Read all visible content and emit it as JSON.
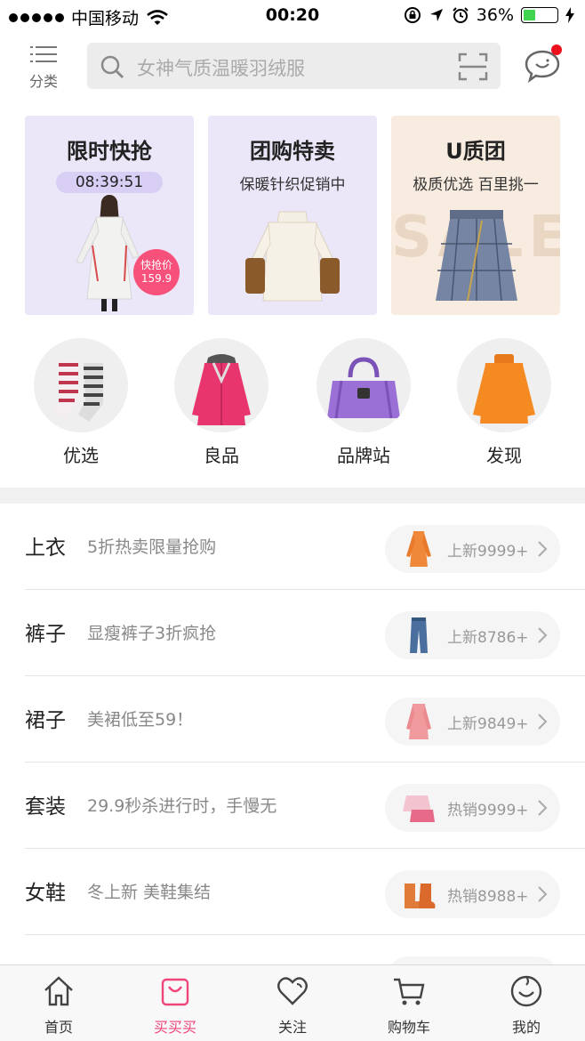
{
  "status_bar": {
    "carrier": "中国移动",
    "time": "00:20",
    "battery_percent": "36%",
    "battery_level": 0.36,
    "battery_color": "#3fd34f"
  },
  "header": {
    "category_label": "分类",
    "search_placeholder": "女神气质温暖羽绒服",
    "icons": [
      "list-icon",
      "search-icon",
      "scan-icon",
      "message-icon"
    ],
    "notification_dot_color": "#f0101d"
  },
  "promos": [
    {
      "title": "限时快抢",
      "timer": "08:39:51",
      "badge_label": "快抢价",
      "badge_price": "159.9",
      "bg": "#ebe6f8"
    },
    {
      "title": "团购特卖",
      "subtitle": "保暖针织促销中",
      "bg": "#ebe6f8"
    },
    {
      "title": "U质团",
      "subtitle": "极质优选 百里挑一",
      "watermark": "SALE",
      "bg": "#f8ece0"
    }
  ],
  "circles": [
    {
      "label": "优选",
      "icon": "socks-icon"
    },
    {
      "label": "良品",
      "icon": "coat-icon"
    },
    {
      "label": "品牌站",
      "icon": "handbag-icon"
    },
    {
      "label": "发现",
      "icon": "sweater-icon"
    }
  ],
  "list": [
    {
      "title": "上衣",
      "subtitle": "5折热卖限量抢购",
      "pill": "上新9999+",
      "icon": "trench-coat-icon"
    },
    {
      "title": "裤子",
      "subtitle": "显瘦裤子3折疯抢",
      "pill": "上新8786+",
      "icon": "jeans-icon"
    },
    {
      "title": "裙子",
      "subtitle": "美裙低至59！",
      "pill": "上新9849+",
      "icon": "pink-coat-icon"
    },
    {
      "title": "套装",
      "subtitle": "29.9秒杀进行时，手慢无",
      "pill": "热销9999+",
      "icon": "outfit-icon"
    },
    {
      "title": "女鞋",
      "subtitle": "冬上新 美鞋集结",
      "pill": "热销8988+",
      "icon": "boots-icon"
    }
  ],
  "tabs": [
    {
      "label": "首页",
      "icon": "home-icon",
      "active": false
    },
    {
      "label": "买买买",
      "icon": "shopping-bag-icon",
      "active": true
    },
    {
      "label": "关注",
      "icon": "heart-icon",
      "active": false
    },
    {
      "label": "购物车",
      "icon": "cart-icon",
      "active": false
    },
    {
      "label": "我的",
      "icon": "profile-icon",
      "active": false
    }
  ],
  "accent_color": "#f0457a"
}
